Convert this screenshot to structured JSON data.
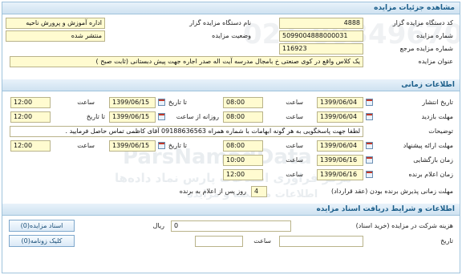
{
  "section1": {
    "title": "مشاهده جزئیات مزایده",
    "org_code_label": "کد دستگاه مزایده گزار",
    "org_code": "4888",
    "org_name_label": "نام دستگاه مزایده گزار",
    "org_name": "اداره آموزش و پرورش ناحیه",
    "auction_no_label": "شماره مزایده",
    "auction_no": "5099004888000031",
    "status_label": "وضعیت مزایده",
    "status": "منتشر شده",
    "ref_no_label": "شماره مزایده مرجع",
    "ref_no": "116923",
    "subject_label": "عنوان مزایده",
    "subject": "یک کلاس  واقع در  کوی صنعتی خ بامجال  مدرسه  آیت اله صدر  اجاره جهت پیش دبستانی  (ثابت صبح )"
  },
  "section2": {
    "title": "اطلاعات زمانی",
    "publish": {
      "label": "تاریخ انتشار",
      "from_date": "1399/06/04",
      "time_label": "ساعت",
      "from_time": "08:00",
      "to_label": "تا تاریخ",
      "to_date": "1399/06/15",
      "to_time": "12:00"
    },
    "visit": {
      "label": "مهلت بازدید",
      "from_date": "1399/06/04",
      "time_label": "ساعت",
      "from_time": "08:00",
      "daily_label": "روزانه از ساعت",
      "to_label": "تا تاریخ",
      "to_date": "1399/06/15",
      "to_time": "12:00"
    },
    "notes_label": "توضیحات",
    "notes": "لطفا جهت پاسخگویی  به هر  گونه ابهامات با شماره همراه 09188636563 آقای کاظمی تماس حاصل فرمایید .",
    "bid_deadline": {
      "label": "مهلت ارائه پیشنهاد",
      "from_date": "1399/06/04",
      "time_label": "ساعت",
      "from_time": "08:00",
      "to_label": "تا تاریخ",
      "to_date": "1399/06/15",
      "to_time": "12:00"
    },
    "opening": {
      "label": "زمان بازگشایی",
      "date": "1399/06/16",
      "time_label": "ساعت",
      "time": "10:00"
    },
    "winner": {
      "label": "زمان اعلام برنده",
      "date": "1399/06/16",
      "time_label": "ساعت",
      "time": "12:00"
    },
    "validity_label": "مهلت زمانی پذیرش برنده بودن (عقد قرارداد)",
    "validity_value": "4",
    "validity_suffix": "روز پس از اعلام به برنده"
  },
  "section3": {
    "title": "اطلاعات و شرایط دریافت اسناد مزایده",
    "fee_label": "هزینه شرکت در مزایده (خرید اسناد)",
    "fee_value": "0",
    "currency": "ریال",
    "docs_button": "اسناد مزایده(0)",
    "bulletin_button": "کلیک زونامه(0)",
    "date_label": "تاریخ",
    "time_label": "ساعت",
    "date_value": "",
    "time_value": ""
  },
  "watermark": {
    "line1": "ParsNamadData",
    "line2": "مرکز فراوری اطلاعات پارس نماد داده‌ها",
    "line3": "اطلاعات مناقصه و مزایده",
    "phone": "021-88349670"
  },
  "colors": {
    "header_bg": "#cfe2f1",
    "header_text": "#1b5e8a",
    "field_bg": "#fffbd0",
    "border": "#9fc3dc"
  }
}
